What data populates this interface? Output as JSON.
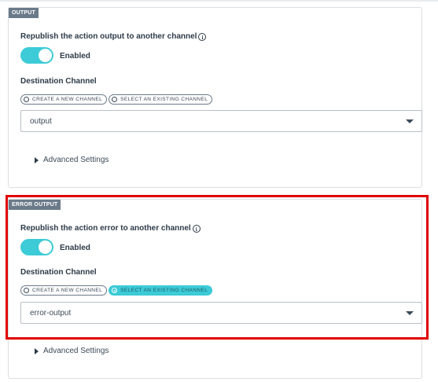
{
  "output_section": {
    "tag": "OUTPUT",
    "title": "Republish the action output to another channel",
    "toggle_label": "Enabled",
    "destination_title": "Destination Channel",
    "option_new": "CREATE A NEW CHANNEL",
    "option_existing": "SELECT AN EXISTING CHANNEL",
    "selected_option": "CREATE A NEW CHANNEL",
    "channel_value": "output",
    "advanced_label": "Advanced Settings"
  },
  "error_section": {
    "tag": "ERROR OUTPUT",
    "title": "Republish the action error to another channel",
    "toggle_label": "Enabled",
    "destination_title": "Destination Channel",
    "option_new": "CREATE A NEW CHANNEL",
    "option_existing": "SELECT AN EXISTING CHANNEL",
    "selected_option": "SELECT AN EXISTING CHANNEL",
    "channel_value": "error-output",
    "advanced_label": "Advanced Settings"
  },
  "icons": {
    "info": "info-circle-icon",
    "dropdown": "caret-down-icon",
    "expand": "caret-right-icon"
  },
  "colors": {
    "accent": "#3ccbd7",
    "tag_bg": "#6b7a89",
    "highlight": "#e00000"
  }
}
